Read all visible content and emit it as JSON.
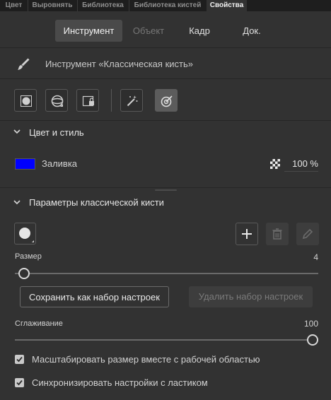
{
  "panel_tabs": [
    "Цвет",
    "Выровнять",
    "Библиотека",
    "Библиотека кистей",
    "Свойства"
  ],
  "sub_tabs": [
    "Инструмент",
    "Объект",
    "Кадр",
    "Док."
  ],
  "tool": {
    "name": "Инструмент «Классическая кисть»"
  },
  "color_style": {
    "title": "Цвет и стиль",
    "fill_label": "Заливка",
    "fill_color": "#0000ff",
    "opacity": "100 %"
  },
  "brush_params": {
    "title": "Параметры классической кисти",
    "size_label": "Размер",
    "size_value": "4",
    "save_preset_label": "Сохранить как набор настроек",
    "delete_preset_label": "Удалить набор настроек",
    "smoothing_label": "Сглаживание",
    "smoothing_value": "100",
    "scale_with_stage_label": "Масштабировать размер вместе с рабочей областью",
    "sync_with_eraser_label": "Синхронизировать настройки с ластиком"
  }
}
